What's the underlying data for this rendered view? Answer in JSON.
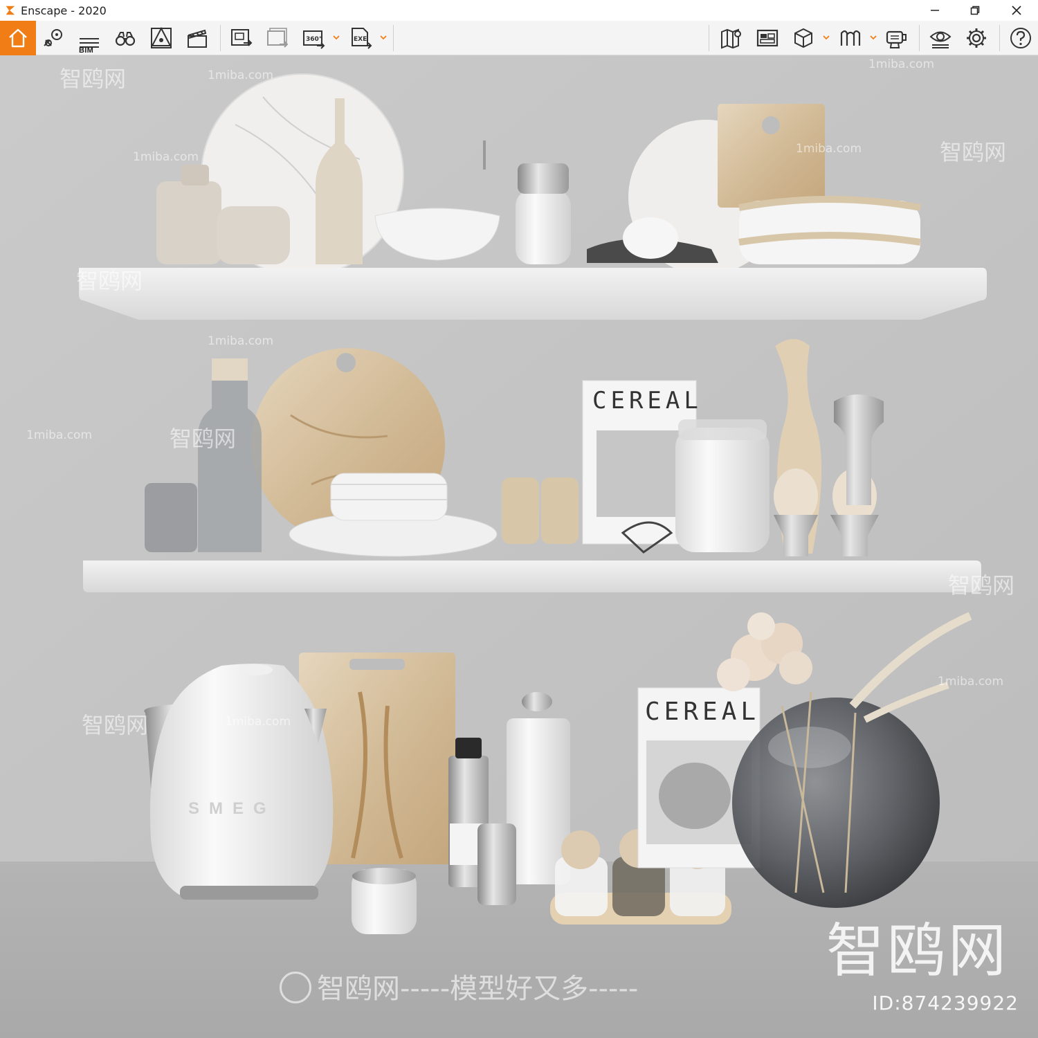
{
  "window": {
    "title": "Enscape - 2020",
    "controls": [
      "minimize",
      "restore",
      "close"
    ]
  },
  "toolbar": {
    "bim_label": "BIM",
    "left_tools": [
      {
        "icon": "home-icon",
        "active": true
      },
      {
        "icon": "map-pin-icon"
      },
      {
        "icon": "bim-info-icon"
      },
      {
        "icon": "binoculars-icon"
      },
      {
        "icon": "asset-library-icon"
      },
      {
        "icon": "clapperboard-icon"
      },
      {
        "icon": "screenshot-export-icon"
      },
      {
        "icon": "batch-export-icon"
      },
      {
        "icon": "panorama-360-icon",
        "has_dropdown": true
      },
      {
        "icon": "exe-export-icon",
        "has_dropdown": true
      }
    ],
    "right_tools": [
      {
        "icon": "map-icon"
      },
      {
        "icon": "material-editor-icon"
      },
      {
        "icon": "view-cube-icon",
        "has_dropdown": true
      },
      {
        "icon": "vr-headset-icon",
        "has_dropdown": true
      },
      {
        "icon": "export-settings-icon"
      },
      {
        "icon": "visual-settings-icon"
      },
      {
        "icon": "settings-gear-icon"
      },
      {
        "icon": "help-icon"
      }
    ],
    "accent_color": "#f07d16"
  },
  "scene": {
    "magazine_title_1": "CEREAL",
    "magazine_title_2": "CEREAL",
    "kettle_logo": "SMEG"
  },
  "watermarks": {
    "site": "1miba.com",
    "brand": "智鸥网",
    "slogan": "智鸥网-----模型好又多-----",
    "id_label": "ID:874239922"
  }
}
